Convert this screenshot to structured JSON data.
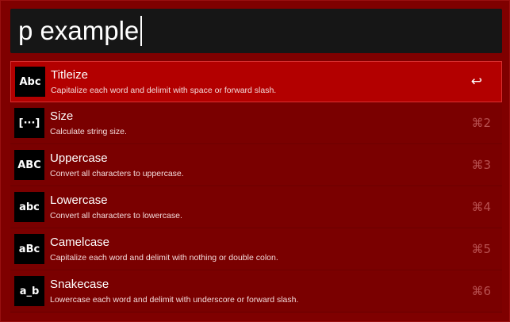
{
  "search": {
    "query": "p example"
  },
  "results": [
    {
      "icon": "Abc",
      "icon_name": "titleize-icon",
      "title": "Titleize",
      "subtitle": "Capitalize each word and delimit with space or forward slash.",
      "shortcut": "↩",
      "selected": true
    },
    {
      "icon": "[···]",
      "icon_name": "size-icon",
      "title": "Size",
      "subtitle": "Calculate string size.",
      "shortcut": "⌘2",
      "selected": false
    },
    {
      "icon": "ABC",
      "icon_name": "uppercase-icon",
      "title": "Uppercase",
      "subtitle": "Convert all characters to uppercase.",
      "shortcut": "⌘3",
      "selected": false
    },
    {
      "icon": "abc",
      "icon_name": "lowercase-icon",
      "title": "Lowercase",
      "subtitle": "Convert all characters to lowercase.",
      "shortcut": "⌘4",
      "selected": false
    },
    {
      "icon": "aBc",
      "icon_name": "camelcase-icon",
      "title": "Camelcase",
      "subtitle": "Capitalize each word and delimit with nothing or double colon.",
      "shortcut": "⌘5",
      "selected": false
    },
    {
      "icon": "a_b",
      "icon_name": "snakecase-icon",
      "title": "Snakecase",
      "subtitle": "Lowercase each word and delimit with underscore or forward slash.",
      "shortcut": "⌘6",
      "selected": false
    }
  ],
  "colors": {
    "background": "#7f0000",
    "selected_row": "#b30000",
    "search_box": "#161616"
  }
}
